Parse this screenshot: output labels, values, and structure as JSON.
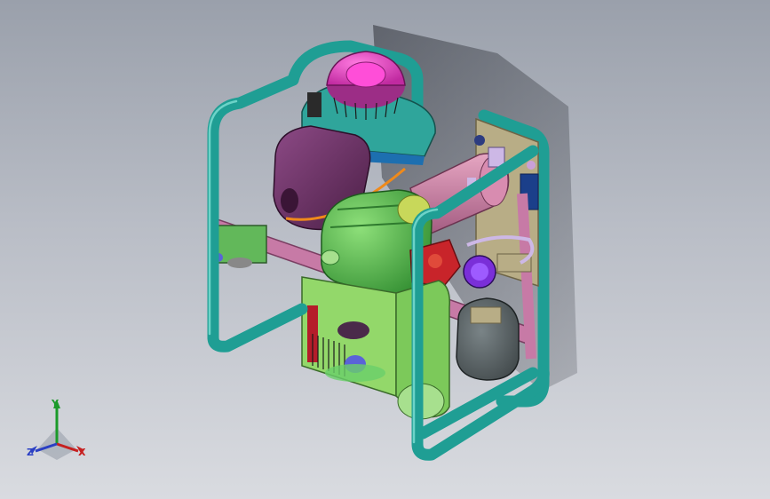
{
  "colors": {
    "background_top": "#9aa0ab",
    "background_bottom": "#d9dbe0",
    "frame": "#1f9e94",
    "crossbar": "#c77aa6",
    "engine_cover": "#6e2f66",
    "recoil_starter": "#e83cc4",
    "fan_shroud": "#2fa59b",
    "tank": "#4ab54a",
    "pump_body": "#93d86a",
    "muffler": "#5a6467",
    "pipe": "#c8809c",
    "pressure_gauge": "#7a2fd8"
  },
  "triad": {
    "y_label": "Y",
    "x_label": "X",
    "z_label": "Z",
    "y_color": "#1b9a2a",
    "x_color": "#c62020",
    "z_color": "#2a3fc4"
  }
}
